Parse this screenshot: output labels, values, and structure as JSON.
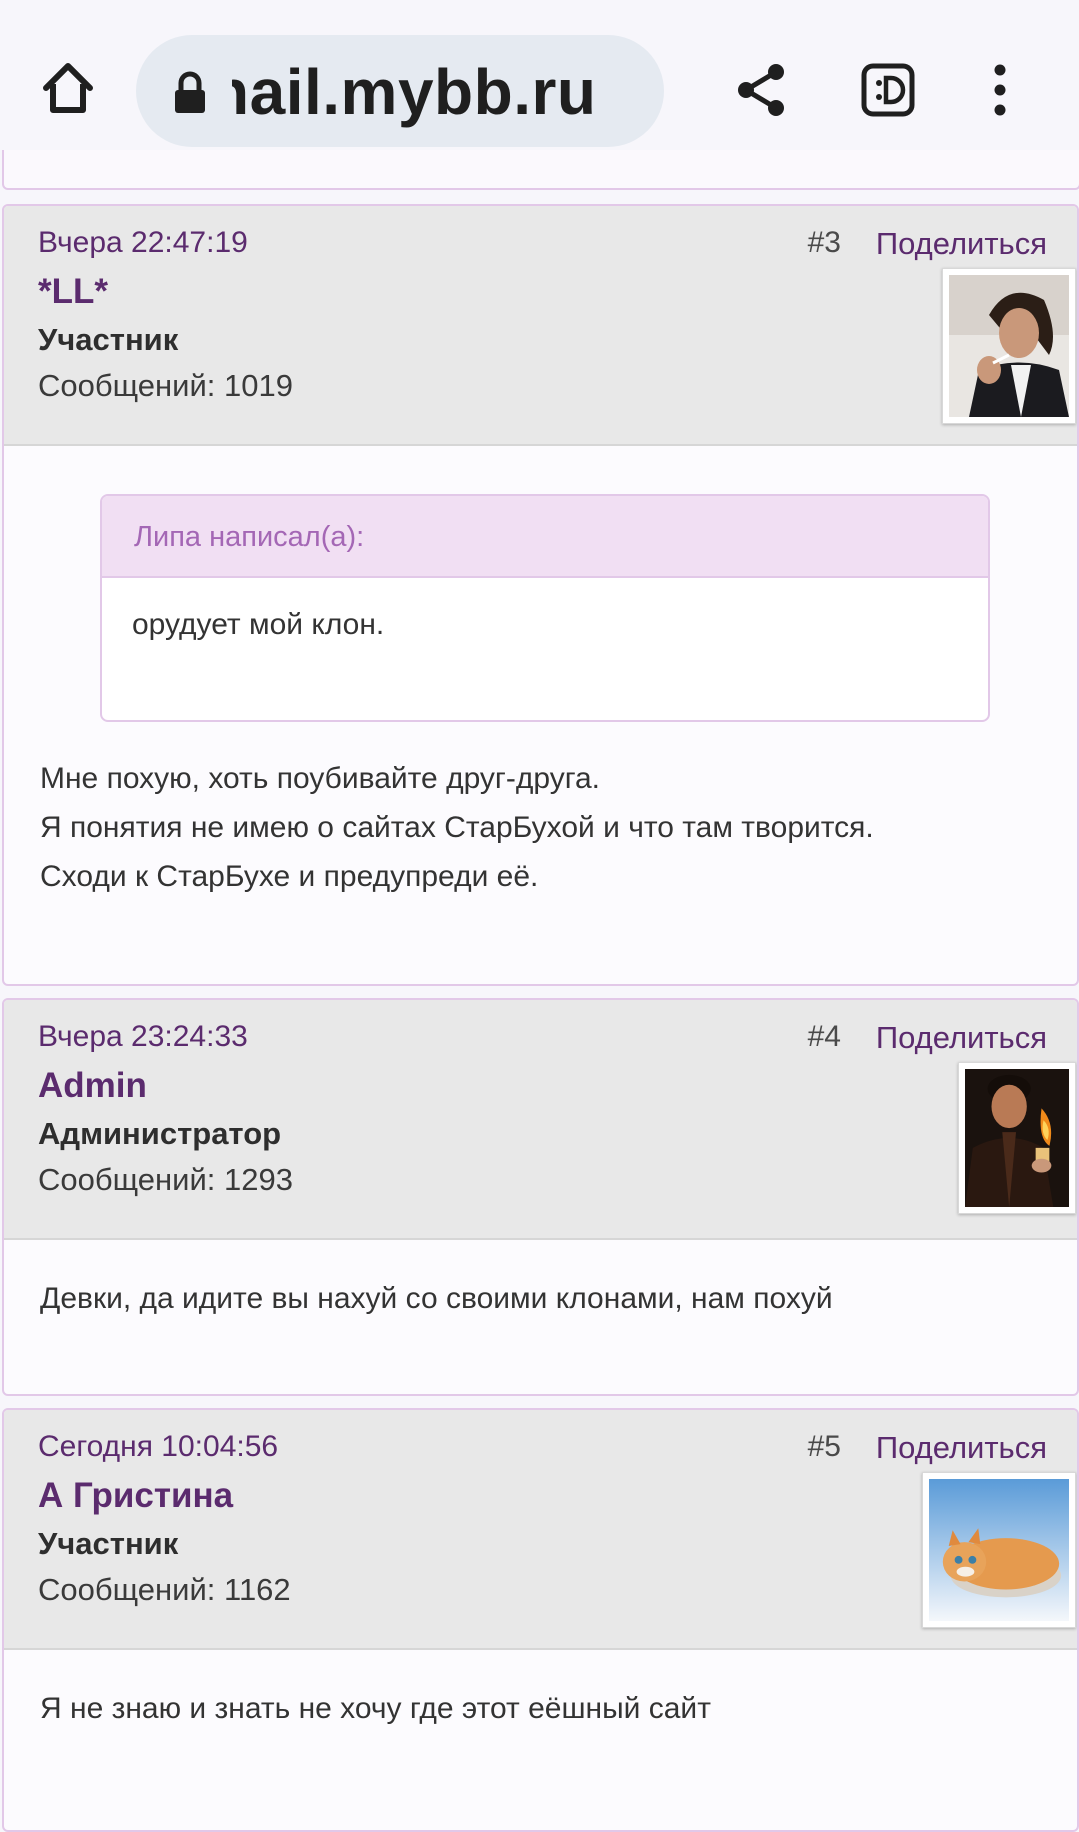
{
  "browser": {
    "url": "nail.mybb.ru"
  },
  "posts": [
    {
      "timestamp": "Вчера 22:47:19",
      "number": "#3",
      "share_label": "Поделиться",
      "username": "*LL*",
      "role": "Участник",
      "messages": "Сообщений: 1019",
      "quote": {
        "author": "Липа написал(а):",
        "text": "орудует мой клон."
      },
      "lines": [
        "Мне похую, хоть поубивайте друг-друга.",
        "Я понятия не имею о сайтах СтарБухой и что там творится.",
        "Сходи к СтарБухе и предупреди  её."
      ]
    },
    {
      "timestamp": "Вчера 23:24:33",
      "number": "#4",
      "share_label": "Поделиться",
      "username": "Admin",
      "role": "Администратор",
      "messages": "Сообщений: 1293",
      "lines": [
        "Девки, да идите вы нахуй со своими клонами, нам похуй"
      ]
    },
    {
      "timestamp": "Сегодня 10:04:56",
      "number": "#5",
      "share_label": "Поделиться",
      "username": "А Гристина",
      "role": "Участник",
      "messages": "Сообщений: 1162",
      "lines": [
        "Я не знаю и знать не хочу где этот еёшный сайт"
      ]
    }
  ]
}
